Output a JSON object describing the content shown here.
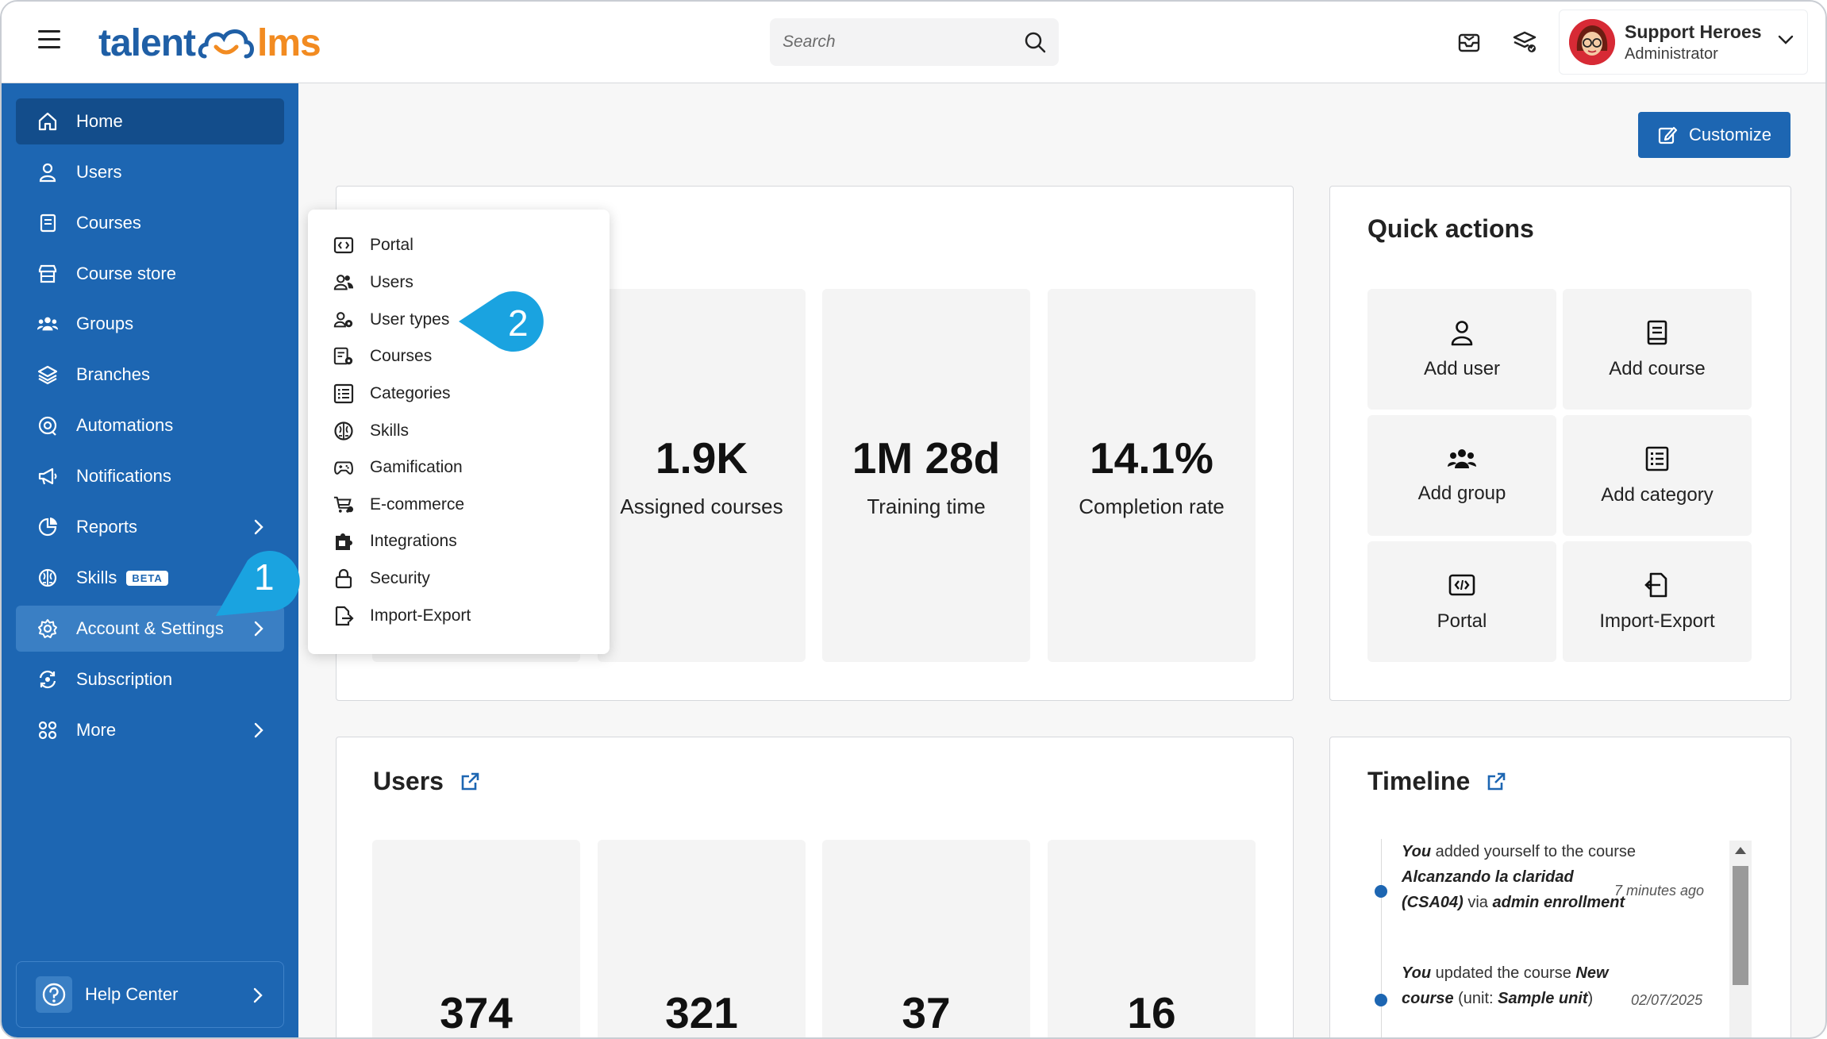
{
  "header": {
    "logo_part1": "talent",
    "logo_part2": "lms",
    "search_placeholder": "Search",
    "user_name": "Support Heroes",
    "user_role": "Administrator",
    "brand_blue": "#1f5fa6",
    "brand_orange": "#f28b21"
  },
  "sidebar": {
    "items": [
      {
        "label": "Home",
        "icon": "home-icon"
      },
      {
        "label": "Users",
        "icon": "user-icon"
      },
      {
        "label": "Courses",
        "icon": "book-icon"
      },
      {
        "label": "Course store",
        "icon": "store-icon"
      },
      {
        "label": "Groups",
        "icon": "groups-icon"
      },
      {
        "label": "Branches",
        "icon": "layers-icon"
      },
      {
        "label": "Automations",
        "icon": "automation-icon"
      },
      {
        "label": "Notifications",
        "icon": "megaphone-icon"
      },
      {
        "label": "Reports",
        "icon": "pie-chart-icon"
      },
      {
        "label": "Skills",
        "icon": "brain-icon",
        "badge": "BETA"
      },
      {
        "label": "Account & Settings",
        "icon": "gear-icon"
      },
      {
        "label": "Subscription",
        "icon": "subscription-icon"
      },
      {
        "label": "More",
        "icon": "grid-icon"
      }
    ],
    "help_label": "Help Center",
    "color": "#1d66b2"
  },
  "dropdown": {
    "items": [
      {
        "label": "Portal",
        "icon": "portal-icon"
      },
      {
        "label": "Users",
        "icon": "users-icon"
      },
      {
        "label": "User types",
        "icon": "user-type-icon"
      },
      {
        "label": "Courses",
        "icon": "course-settings-icon"
      },
      {
        "label": "Categories",
        "icon": "categories-icon"
      },
      {
        "label": "Skills",
        "icon": "brain-icon"
      },
      {
        "label": "Gamification",
        "icon": "gamepad-icon"
      },
      {
        "label": "E-commerce",
        "icon": "cart-icon"
      },
      {
        "label": "Integrations",
        "icon": "puzzle-icon"
      },
      {
        "label": "Security",
        "icon": "lock-icon"
      },
      {
        "label": "Import-Export",
        "icon": "import-export-icon"
      }
    ]
  },
  "callouts": {
    "first": "1",
    "second": "2",
    "color": "#1aa3e0"
  },
  "main": {
    "customize_label": "Customize",
    "overview_stats": [
      {
        "value": "1.9K",
        "label": "Assigned courses"
      },
      {
        "value": "1M 28d",
        "label": "Training time"
      },
      {
        "value": "14.1%",
        "label": "Completion rate"
      }
    ],
    "quick_actions": {
      "title": "Quick actions",
      "items": [
        {
          "label": "Add user",
          "icon": "add-user-icon"
        },
        {
          "label": "Add course",
          "icon": "add-course-icon"
        },
        {
          "label": "Add group",
          "icon": "add-group-icon"
        },
        {
          "label": "Add category",
          "icon": "add-category-icon"
        },
        {
          "label": "Portal",
          "icon": "portal-icon"
        },
        {
          "label": "Import-Export",
          "icon": "import-export-icon"
        }
      ]
    },
    "users_card": {
      "title": "Users",
      "stats": [
        "374",
        "321",
        "37",
        "16"
      ]
    },
    "timeline": {
      "title": "Timeline",
      "entries": [
        {
          "actor": "You",
          "action": " added yourself to the course ",
          "object": "Alcanzando la claridad (CSA04)",
          "suffix": " via ",
          "extra": "admin enrollment",
          "time": "7 minutes ago"
        },
        {
          "actor": "You",
          "action": " updated the course ",
          "object": "New course",
          "suffix": " (unit: ",
          "extra": "Sample unit",
          "tail": ")",
          "time": "02/07/2025"
        }
      ]
    }
  }
}
